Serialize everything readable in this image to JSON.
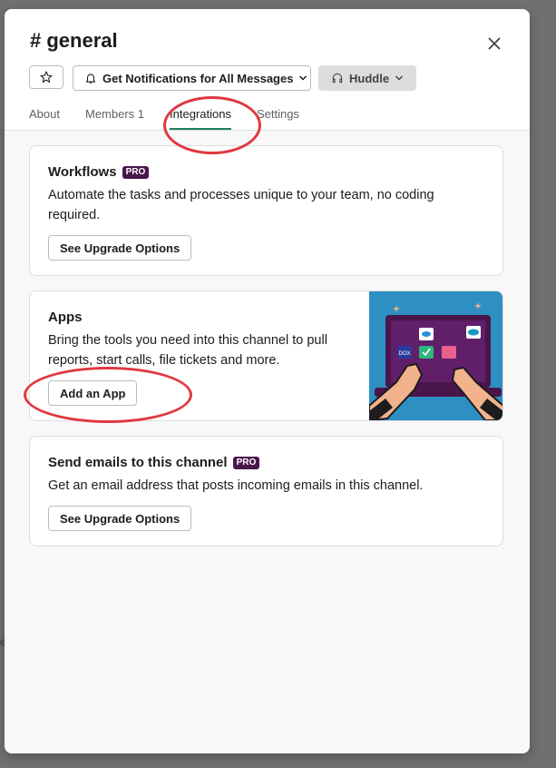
{
  "backdrop": {
    "edge_char": "e"
  },
  "channel": {
    "title": "# general"
  },
  "header_buttons": {
    "notifications_label": "Get Notifications for All Messages",
    "huddle_label": "Huddle"
  },
  "tabs": [
    {
      "label": "About"
    },
    {
      "label": "Members 1"
    },
    {
      "label": "Integrations"
    },
    {
      "label": "Settings"
    }
  ],
  "workflows": {
    "title": "Workflows",
    "badge": "PRO",
    "description": "Automate the tasks and processes unique to your team, no coding required.",
    "button_label": "See Upgrade Options"
  },
  "apps": {
    "title": "Apps",
    "description": "Bring the tools you need into this channel to pull reports, start calls, file tickets and more.",
    "button_label": "Add an App",
    "illustration_tile_text": "DOX"
  },
  "email": {
    "title": "Send emails to this channel",
    "badge": "PRO",
    "description": "Get an email address that posts incoming emails in this channel.",
    "button_label": "See Upgrade Options"
  },
  "colors": {
    "active_tab_underline": "#1a7f64",
    "pro_badge": "#4a154b",
    "annotation": "#e0383f",
    "illustration_bg": "#2e8fc3"
  }
}
